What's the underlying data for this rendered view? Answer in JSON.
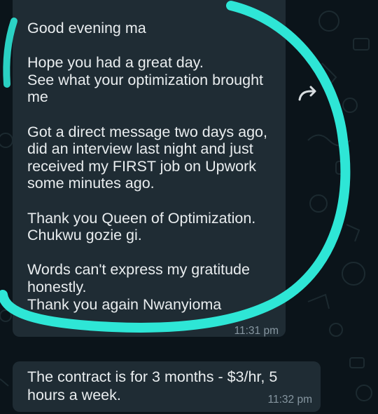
{
  "messages": [
    {
      "text": "Good evening ma\n\nHope you had a great day.\nSee what your optimization brought me\n\nGot a direct message two days ago, did an interview last night and just received my FIRST job on Upwork some minutes ago.\n\nThank you Queen of Optimization.\nChukwu gozie gi.\n\nWords can't express my gratitude honestly.\nThank you again Nwanyioma",
      "time": "11:31 pm"
    },
    {
      "text": "The contract is for 3 months - $3/hr, 5 hours a week.",
      "time": "11:32 pm"
    }
  ],
  "icons": [
    "forward-icon"
  ],
  "colors": {
    "background": "#0b141a",
    "bubble": "#1f2c34",
    "text": "#e9edef",
    "timestamp": "#8696a0",
    "highlight": "#2ee6d6"
  }
}
